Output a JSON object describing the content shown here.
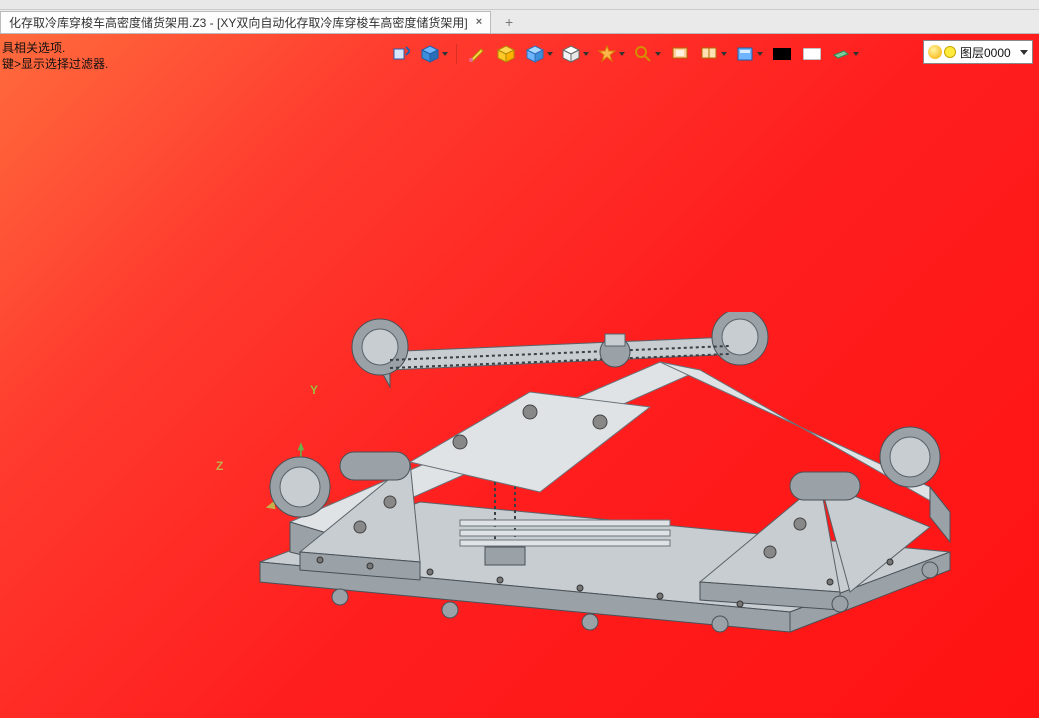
{
  "window": {
    "title_prefix": "化存取冷库穿梭车高密度储货架用.Z3 - ",
    "document_name": "[XY双向自动化存取冷库穿梭车高密度储货架用]"
  },
  "tabs": {
    "active_label": "化存取冷库穿梭车高密度储货架用.Z3 - [XY双向自动化存取冷库穿梭车高密度储货架用]",
    "close_glyph": "×",
    "add_glyph": "+"
  },
  "status": {
    "line1": "具相关选项.",
    "line2": "键>显示选择过滤器."
  },
  "toolbar": {
    "buttons": [
      {
        "name": "insert-component",
        "arrow": false,
        "icon": "insert"
      },
      {
        "name": "visual-style",
        "arrow": true,
        "icon": "cube-blue"
      },
      {
        "name": "brush-tool",
        "arrow": false,
        "icon": "brush"
      },
      {
        "name": "section-view",
        "arrow": false,
        "icon": "section"
      },
      {
        "name": "box-mode",
        "arrow": true,
        "icon": "box-blue"
      },
      {
        "name": "wireframe",
        "arrow": true,
        "icon": "box-wire"
      },
      {
        "name": "render-mode",
        "arrow": true,
        "icon": "badge-orange"
      },
      {
        "name": "zoom-fit",
        "arrow": true,
        "icon": "magnifier"
      },
      {
        "name": "viewport1",
        "arrow": false,
        "icon": "screen1"
      },
      {
        "name": "viewport2",
        "arrow": true,
        "icon": "screen2"
      },
      {
        "name": "display-style",
        "arrow": true,
        "icon": "panel-blue"
      },
      {
        "name": "swatch-black",
        "arrow": false,
        "icon": "sw-black"
      },
      {
        "name": "swatch-white",
        "arrow": false,
        "icon": "sw-white"
      },
      {
        "name": "material",
        "arrow": true,
        "icon": "slab-green"
      }
    ]
  },
  "layer": {
    "label": "图层0000"
  },
  "axes": {
    "y": "Y",
    "z": "Z"
  }
}
